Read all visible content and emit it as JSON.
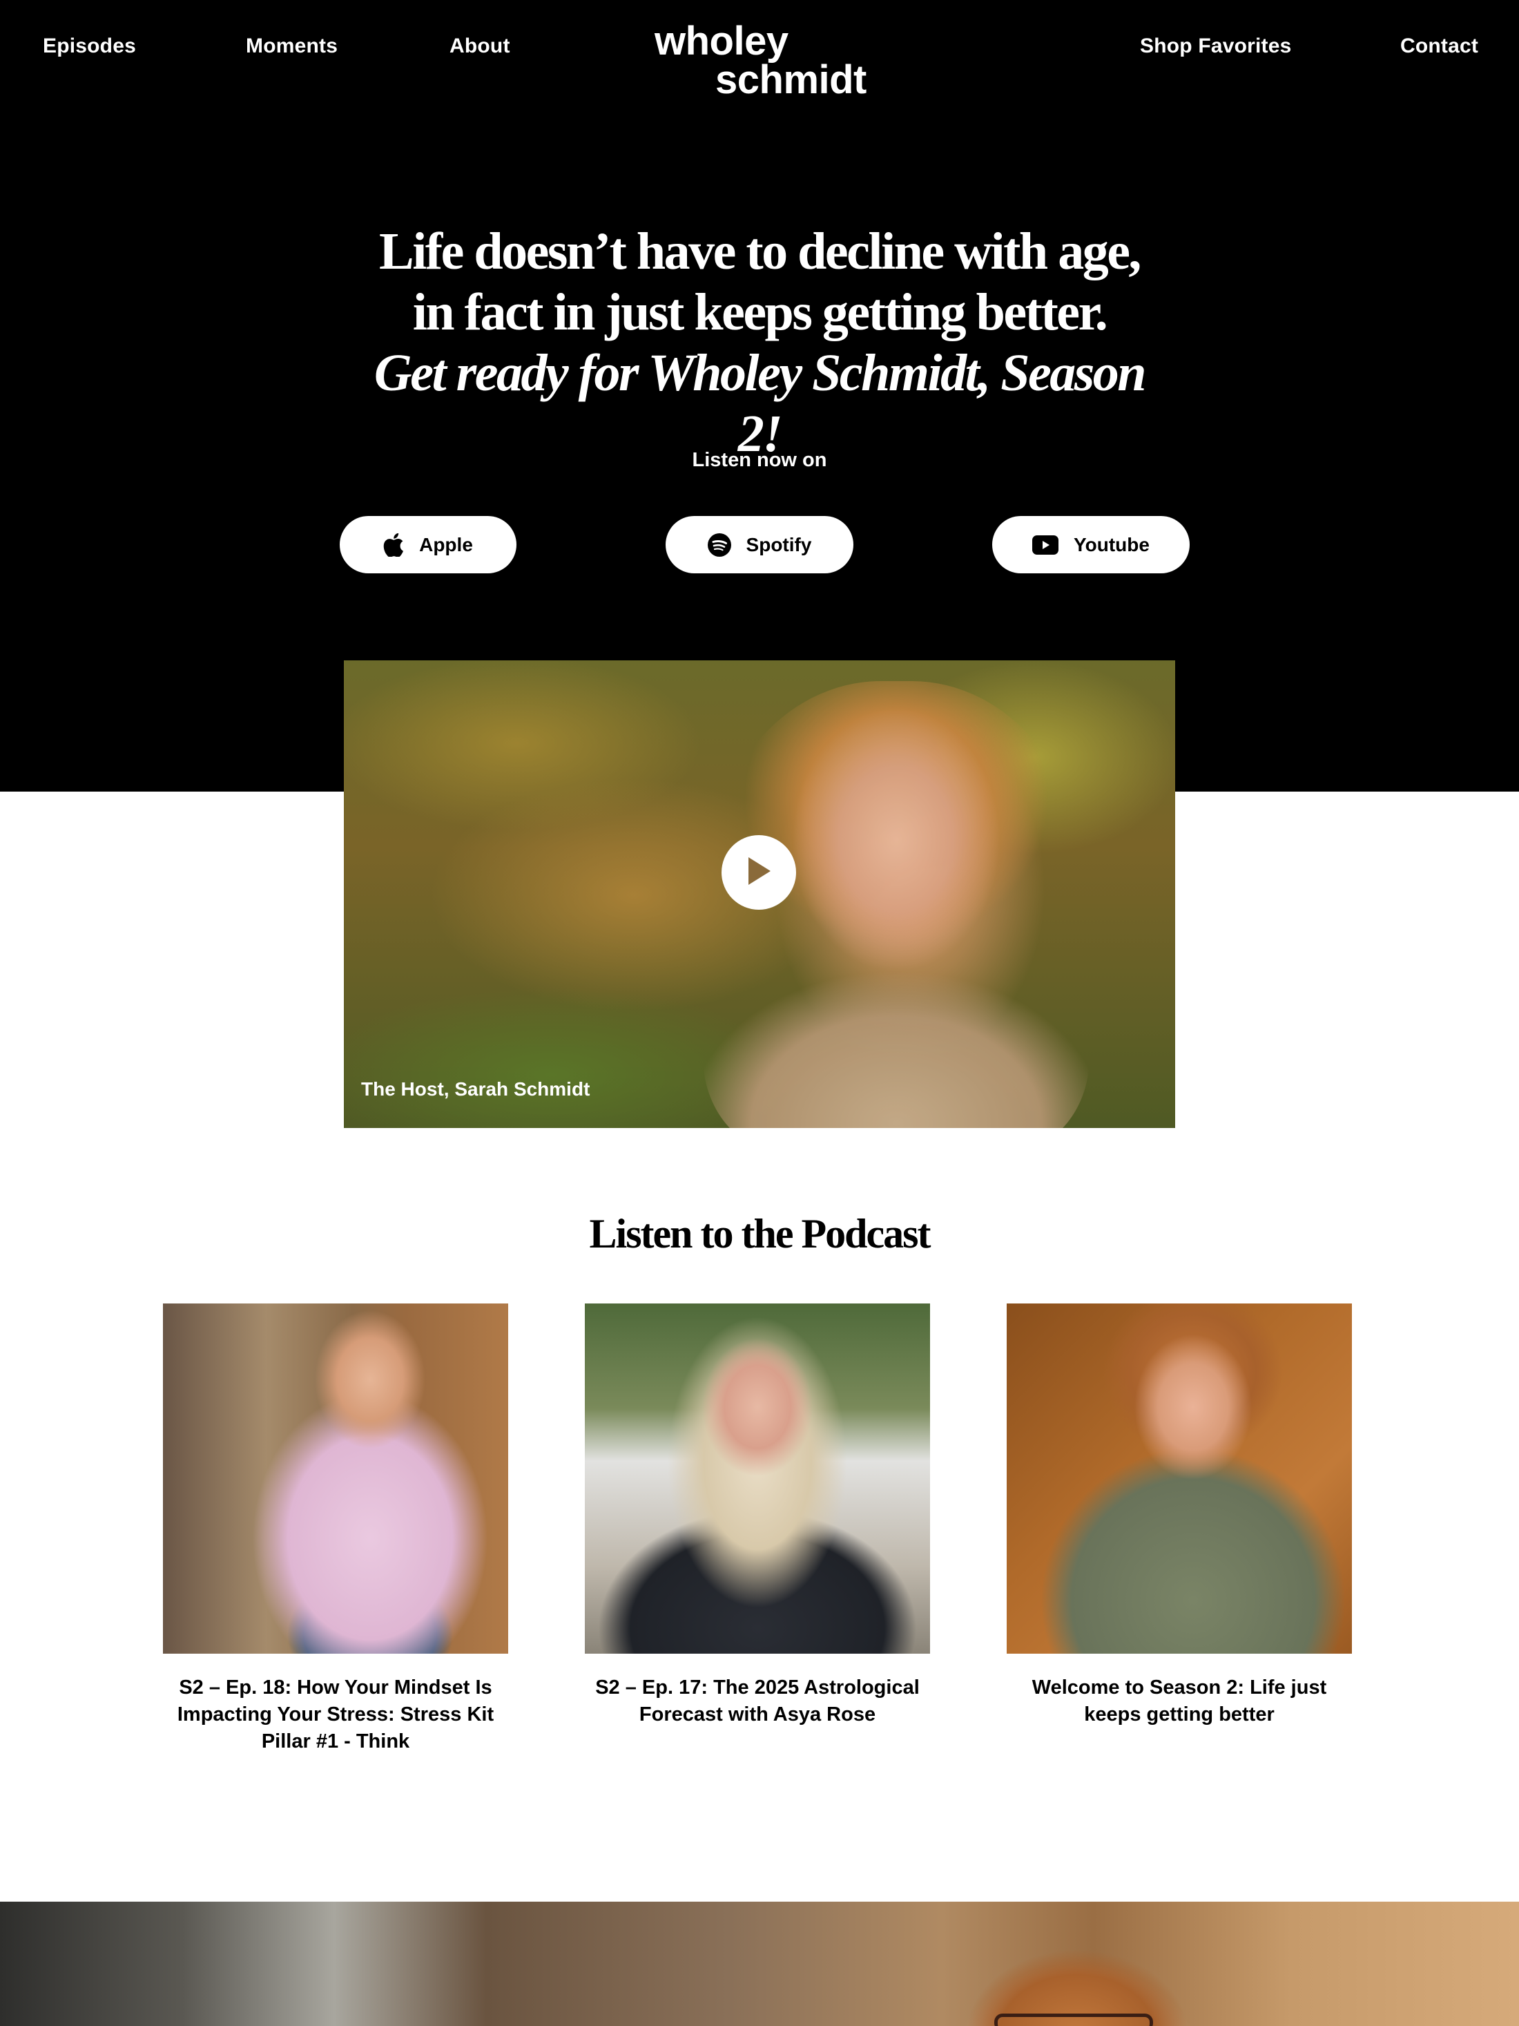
{
  "nav": {
    "left": [
      {
        "label": "Episodes"
      },
      {
        "label": "Moments"
      },
      {
        "label": "About"
      }
    ],
    "right": [
      {
        "label": "Shop Favorites"
      },
      {
        "label": "Contact"
      }
    ]
  },
  "logo": {
    "line1": "wholey",
    "line2": "schmidt"
  },
  "hero": {
    "headline_regular": "Life doesn’t have to decline with age, in fact in just keeps getting better.",
    "headline_italic": "Get ready for Wholey Schmidt, Season 2!",
    "listen_label": "Listen now on",
    "platforms": [
      {
        "label": "Apple",
        "icon": "apple-icon"
      },
      {
        "label": "Spotify",
        "icon": "spotify-icon"
      },
      {
        "label": "Youtube",
        "icon": "youtube-icon"
      }
    ]
  },
  "video": {
    "caption": "The Host, Sarah Schmidt",
    "icon": "play-icon"
  },
  "podcast": {
    "section_title": "Listen to the Podcast",
    "episodes": [
      {
        "title": "S2 – Ep. 18: How Your Mindset Is Impacting Your Stress: Stress Kit Pillar #1 - Think"
      },
      {
        "title": "S2 – Ep. 17: The 2025 Astrological Forecast with Asya Rose"
      },
      {
        "title": "Welcome to Season 2: Life just keeps getting better"
      }
    ]
  },
  "colors": {
    "hero_background": "#000000",
    "page_background": "#ffffff",
    "button_background": "#ffffff"
  }
}
